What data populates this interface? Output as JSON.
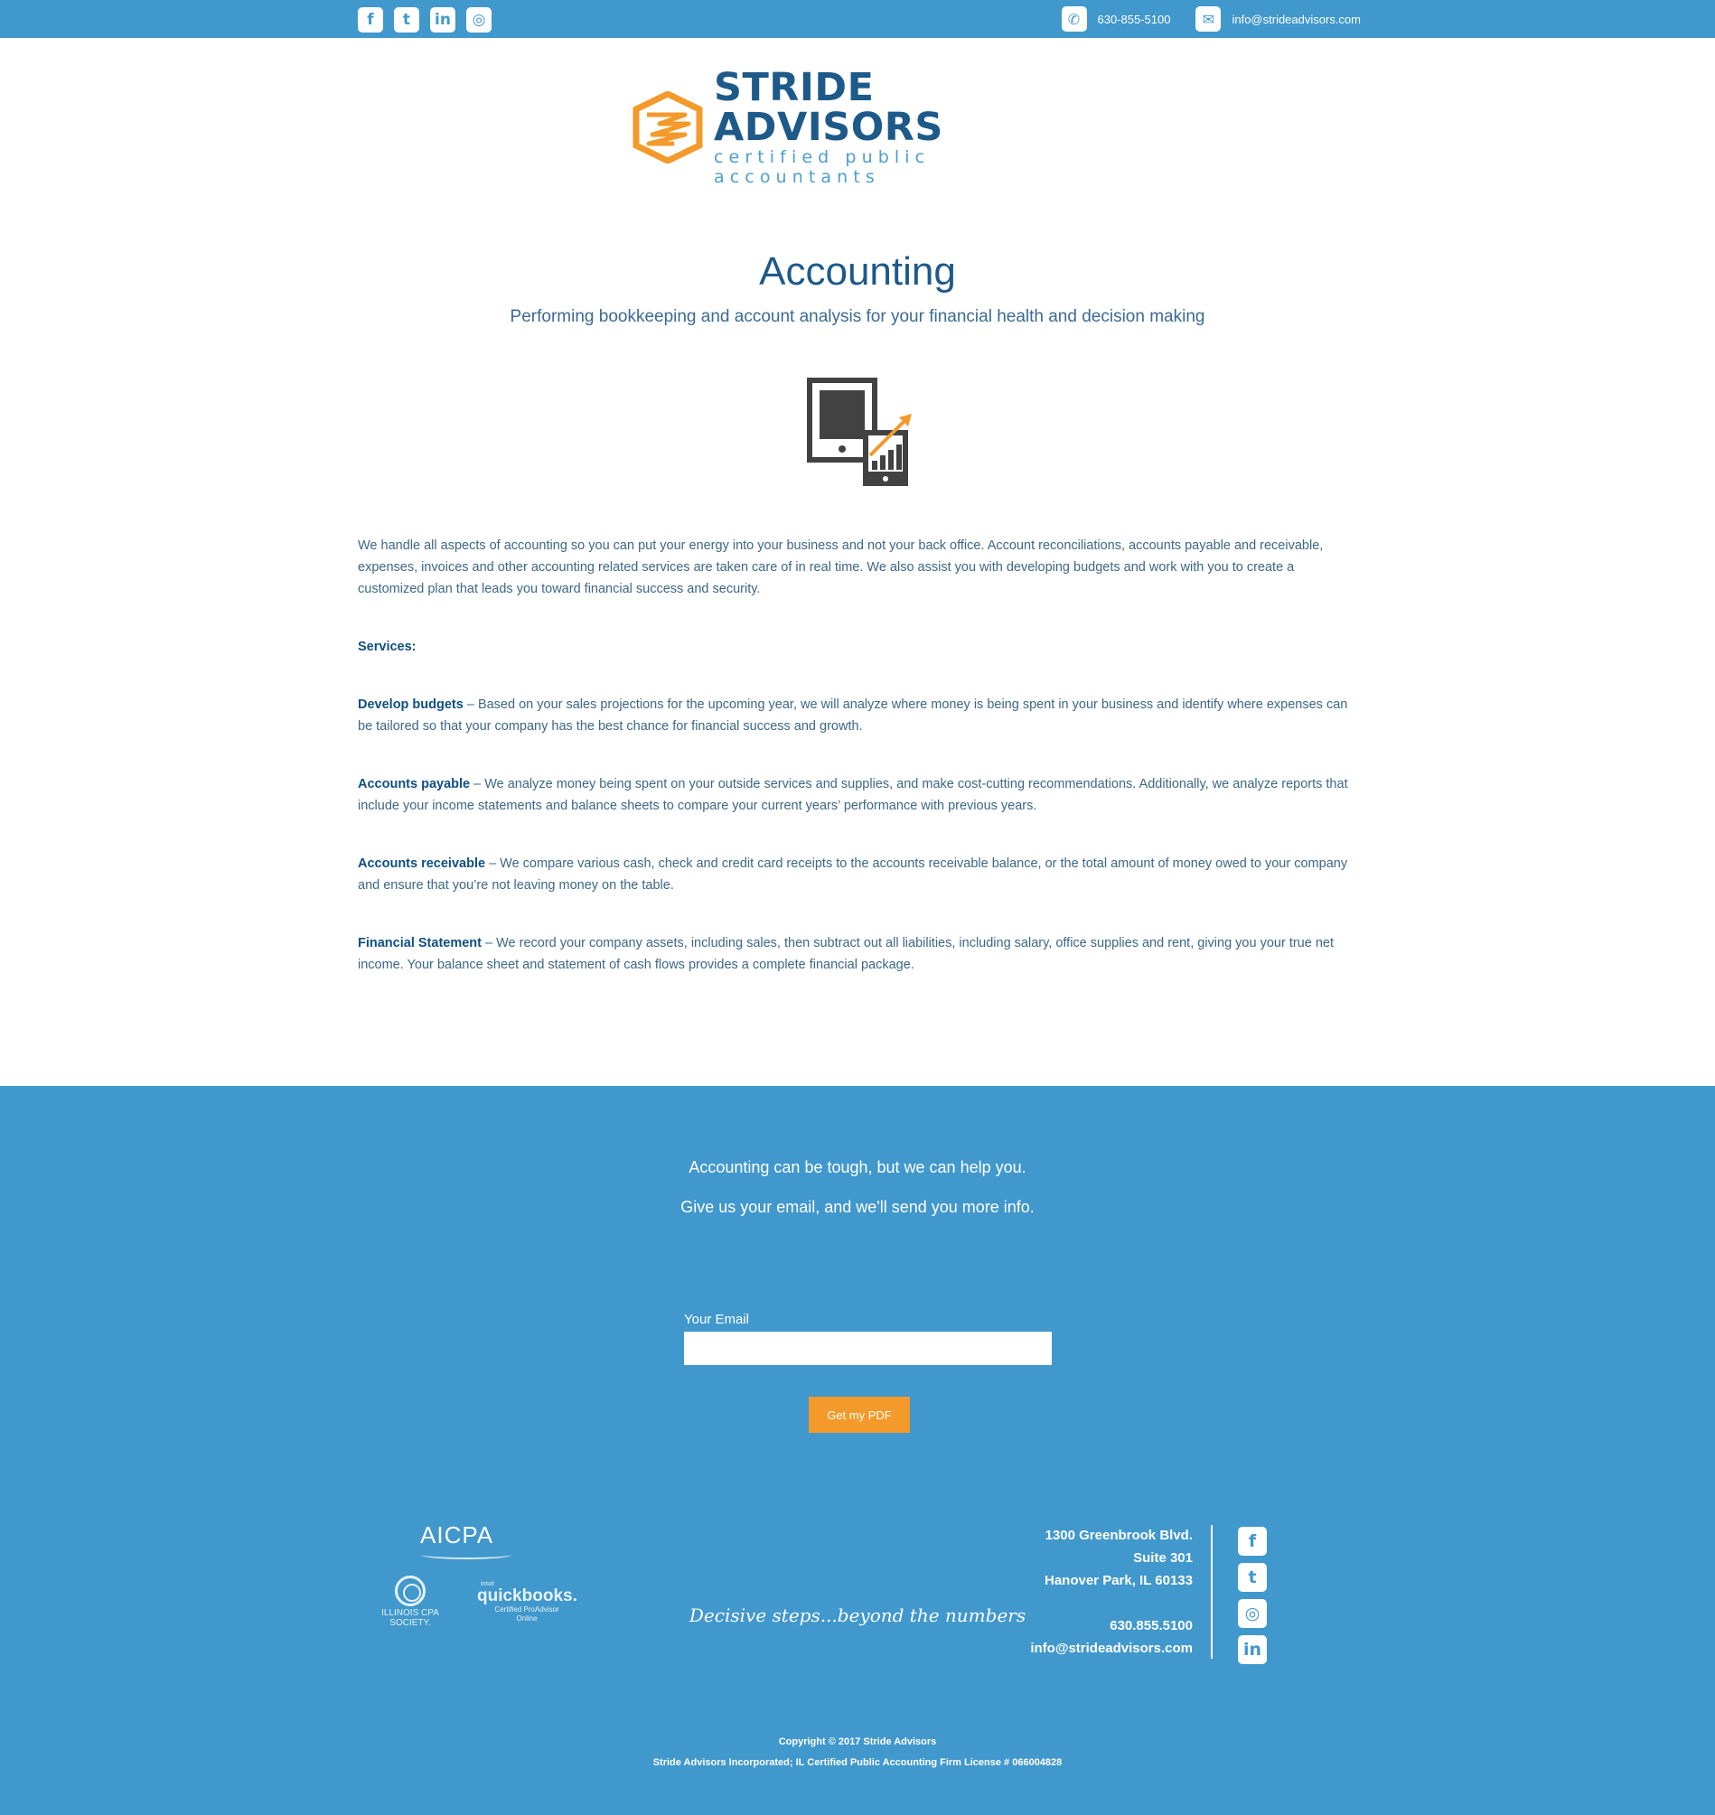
{
  "topbar": {
    "social": [
      {
        "name": "facebook-icon",
        "glyph": "f"
      },
      {
        "name": "twitter-icon",
        "glyph": "t"
      },
      {
        "name": "linkedin-icon",
        "glyph": "in"
      },
      {
        "name": "instagram-icon",
        "glyph": "◎"
      }
    ],
    "phone": "630-855-5100",
    "email": "info@strideadvisors.com"
  },
  "logo": {
    "brand": "STRIDE ADVISORS",
    "tagline": "certified public accountants"
  },
  "page": {
    "title": "Accounting",
    "subtitle": "Performing bookkeeping and account analysis for your financial health and decision making"
  },
  "content": {
    "intro": "We handle all aspects of accounting so you can put your energy into your business and not your back office. Account reconciliations, accounts payable and receivable, expenses, invoices and other accounting related services are taken care of in real time. We also assist you with developing budgets and work with you to create a customized plan that leads you toward financial success and security.",
    "services_heading": "Services:",
    "services": [
      {
        "title": "Develop budgets",
        "text": " – Based on your sales projections for the upcoming year, we will analyze where money is being spent in your business and identify where expenses can be tailored so that your company has the best chance for financial success and growth."
      },
      {
        "title": "Accounts payable",
        "text": " – We analyze money being spent on your outside services and supplies, and make cost-cutting recommendations. Additionally, we analyze reports that include your income statements and balance sheets to compare your current years’ performance with previous years."
      },
      {
        "title": "Accounts receivable",
        "text": " – We compare various cash, check and credit card receipts to the accounts receivable balance, or the total amount of money owed to your company and ensure that you’re not leaving money on the table."
      },
      {
        "title": "Financial Statement",
        "text": " – We record your company assets, including sales, then subtract out all liabilities, including salary, office supplies and rent, giving you your true net income. Your balance sheet and statement of cash flows provides a complete financial package."
      }
    ]
  },
  "footer": {
    "cta_line1": "Accounting can be tough, but we can help you.",
    "cta_line2": "Give us your email, and we'll send you more info.",
    "email_label": "Your Email",
    "email_value": "",
    "button_label": "Get my PDF",
    "logos": {
      "aicpa": "AICPA",
      "ilcpa": "ILLINOIS CPA SOCIETY.",
      "qb_small": "intuit",
      "qb_big": "quickbooks.",
      "qb_sub1": "Certified ProAdvisor",
      "qb_sub2": "Online"
    },
    "slogan": "Decisive steps...beyond the numbers",
    "address_line1": "1300 Greenbrook Blvd.",
    "address_line2": "Suite 301",
    "address_line3": "Hanover Park, IL 60133",
    "phone": "630.855.5100",
    "email": "info@strideadvisors.com",
    "social": [
      {
        "name": "facebook-icon",
        "glyph": "f"
      },
      {
        "name": "twitter-icon",
        "glyph": "t"
      },
      {
        "name": "instagram-icon",
        "glyph": "◎"
      },
      {
        "name": "linkedin-icon",
        "glyph": "in"
      }
    ],
    "copyright": "Copyright © 2017 Stride Advisors",
    "license": "Stride Advisors Incorporated; IL Certified Public Accounting Firm License # 066004828"
  },
  "colors": {
    "brand_blue": "#4198cc",
    "dark_blue": "#1d5a8a",
    "accent_orange": "#f39a2b"
  }
}
